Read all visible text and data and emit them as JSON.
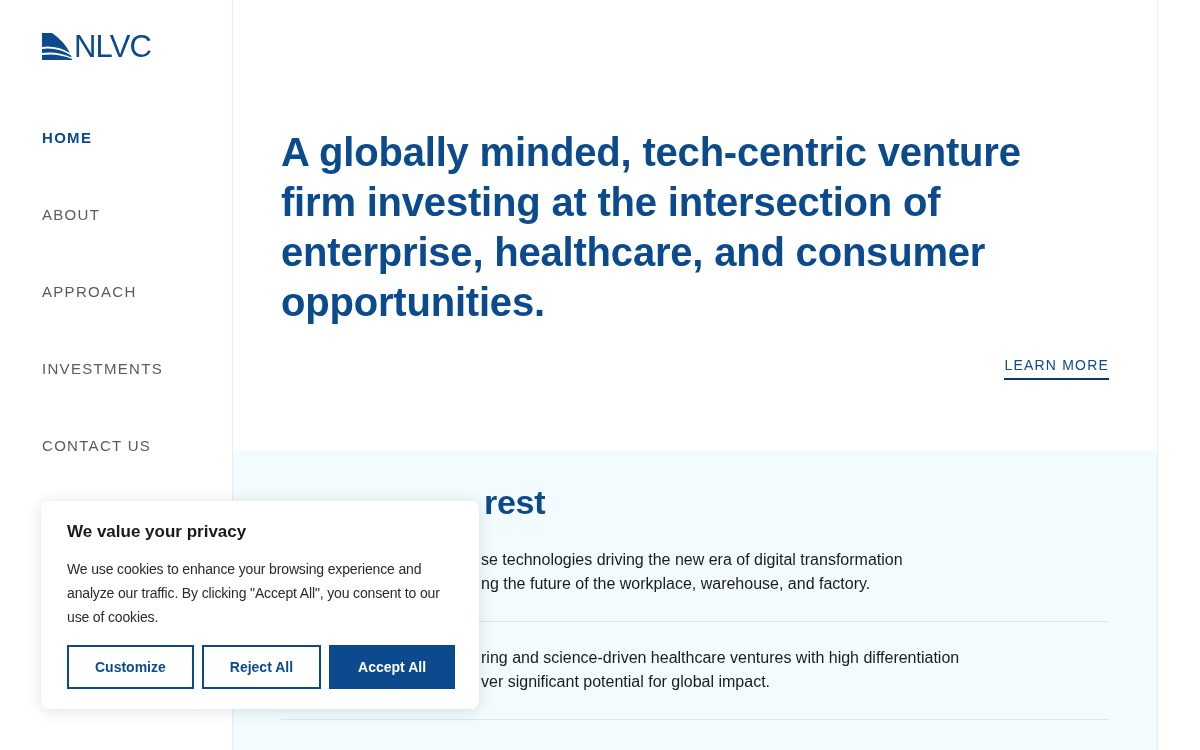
{
  "logo": {
    "text": "NLVC"
  },
  "nav": [
    {
      "label": "HOME",
      "selected": true
    },
    {
      "label": "ABOUT",
      "selected": false
    },
    {
      "label": "APPROACH",
      "selected": false
    },
    {
      "label": "INVESTMENTS",
      "selected": false
    },
    {
      "label": "CONTACT US",
      "selected": false
    }
  ],
  "hero": {
    "heading": "A globally minded, tech-centric venture firm investing at the intersection of enterprise, healthcare, and consumer opportunities.",
    "link": "LEARN MORE"
  },
  "areas": {
    "title": "rest",
    "rows": [
      {
        "lines": [
          "se technologies driving the new era of digital transformation",
          "ng the future of the workplace, warehouse, and factory."
        ]
      },
      {
        "lines": [
          "ring and science-driven healthcare ventures with high differentiation",
          "ver significant potential for global impact."
        ]
      }
    ]
  },
  "cookie_banner": {
    "title": "We value your privacy",
    "text": "We use cookies to enhance your browsing experience and analyze our traffic. By clicking \"Accept All\", you consent to our use of cookies.",
    "buttons": [
      {
        "label": "Customize",
        "kind": "outline"
      },
      {
        "label": "Reject All",
        "kind": "outline"
      },
      {
        "label": "Accept All",
        "kind": "filled"
      }
    ]
  }
}
